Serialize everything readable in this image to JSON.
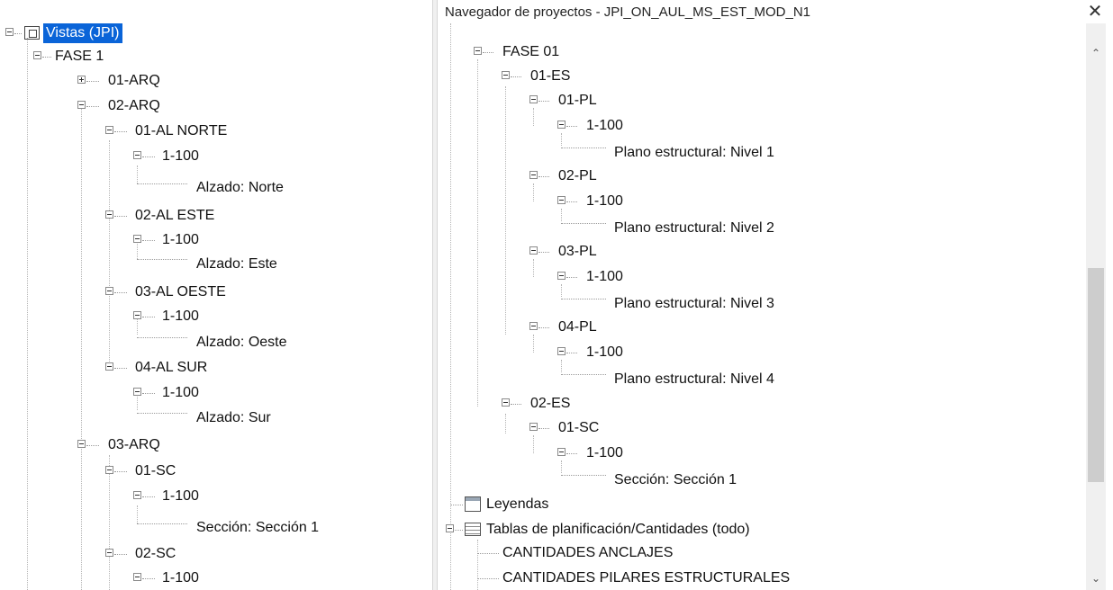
{
  "left_tree": {
    "root_label": "Vistas (JPI)",
    "fase1": "FASE 1",
    "arq01": "01-ARQ",
    "arq02": "02-ARQ",
    "al_norte": "01-AL NORTE",
    "scale_norte": "1-100",
    "alzado_norte": "Alzado: Norte",
    "al_este": "02-AL ESTE",
    "scale_este": "1-100",
    "alzado_este": "Alzado: Este",
    "al_oeste": "03-AL OESTE",
    "scale_oeste": "1-100",
    "alzado_oeste": "Alzado: Oeste",
    "al_sur": "04-AL SUR",
    "scale_sur": "1-100",
    "alzado_sur": "Alzado: Sur",
    "arq03": "03-ARQ",
    "sc01": "01-SC",
    "scale_sc01": "1-100",
    "seccion1": "Sección: Sección 1",
    "sc02": "02-SC",
    "scale_sc02": "1-100"
  },
  "right_panel": {
    "title": "Navegador de proyectos - JPI_ON_AUL_MS_EST_MOD_N1",
    "close_icon": "close-icon",
    "fase01": "FASE 01",
    "es01": "01-ES",
    "pl01": "01-PL",
    "scale_pl01": "1-100",
    "plano1": "Plano estructural: Nivel 1",
    "pl02": "02-PL",
    "scale_pl02": "1-100",
    "plano2": "Plano estructural: Nivel 2",
    "pl03": "03-PL",
    "scale_pl03": "1-100",
    "plano3": "Plano estructural: Nivel 3",
    "pl04": "04-PL",
    "scale_pl04": "1-100",
    "plano4": "Plano estructural: Nivel 4",
    "es02": "02-ES",
    "sc01": "01-SC",
    "scale_sc01": "1-100",
    "seccion1": "Sección: Sección 1",
    "leyendas": "Leyendas",
    "tablas": "Tablas de planificación/Cantidades (todo)",
    "cant_anclajes": "CANTIDADES  ANCLAJES",
    "cant_pilares": "CANTIDADES PILARES ESTRUCTURALES"
  },
  "colors": {
    "selection": "#0a64d8",
    "scrollbar_thumb": "#cdcdcd"
  }
}
